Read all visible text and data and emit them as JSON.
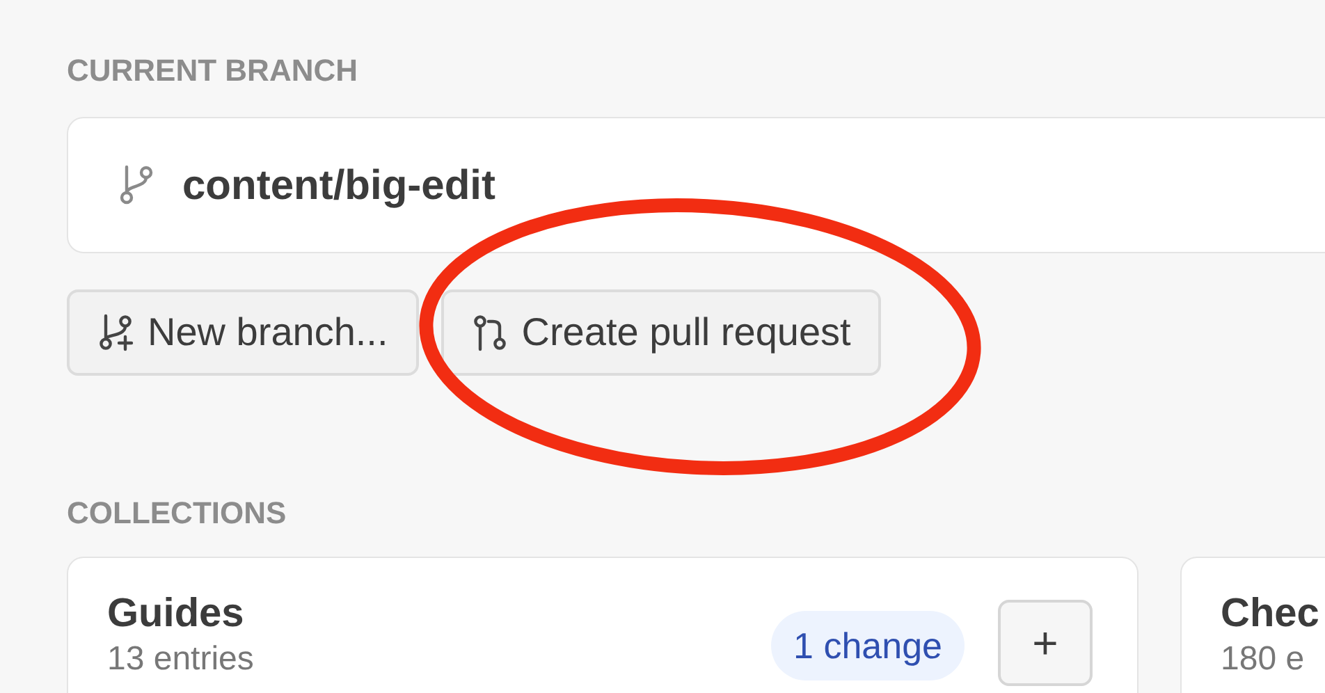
{
  "current_branch": {
    "heading": "CURRENT BRANCH",
    "name": "content/big-edit"
  },
  "actions": [
    {
      "kind": "new-branch",
      "label": "New branch..."
    },
    {
      "kind": "pull-request",
      "label": "Create pull request"
    }
  ],
  "collections": {
    "heading": "COLLECTIONS",
    "items": [
      {
        "title": "Guides",
        "subtitle": "13 entries",
        "badge": "1 change",
        "add": "+"
      },
      {
        "title": "Chec",
        "subtitle": "180 e"
      }
    ]
  }
}
